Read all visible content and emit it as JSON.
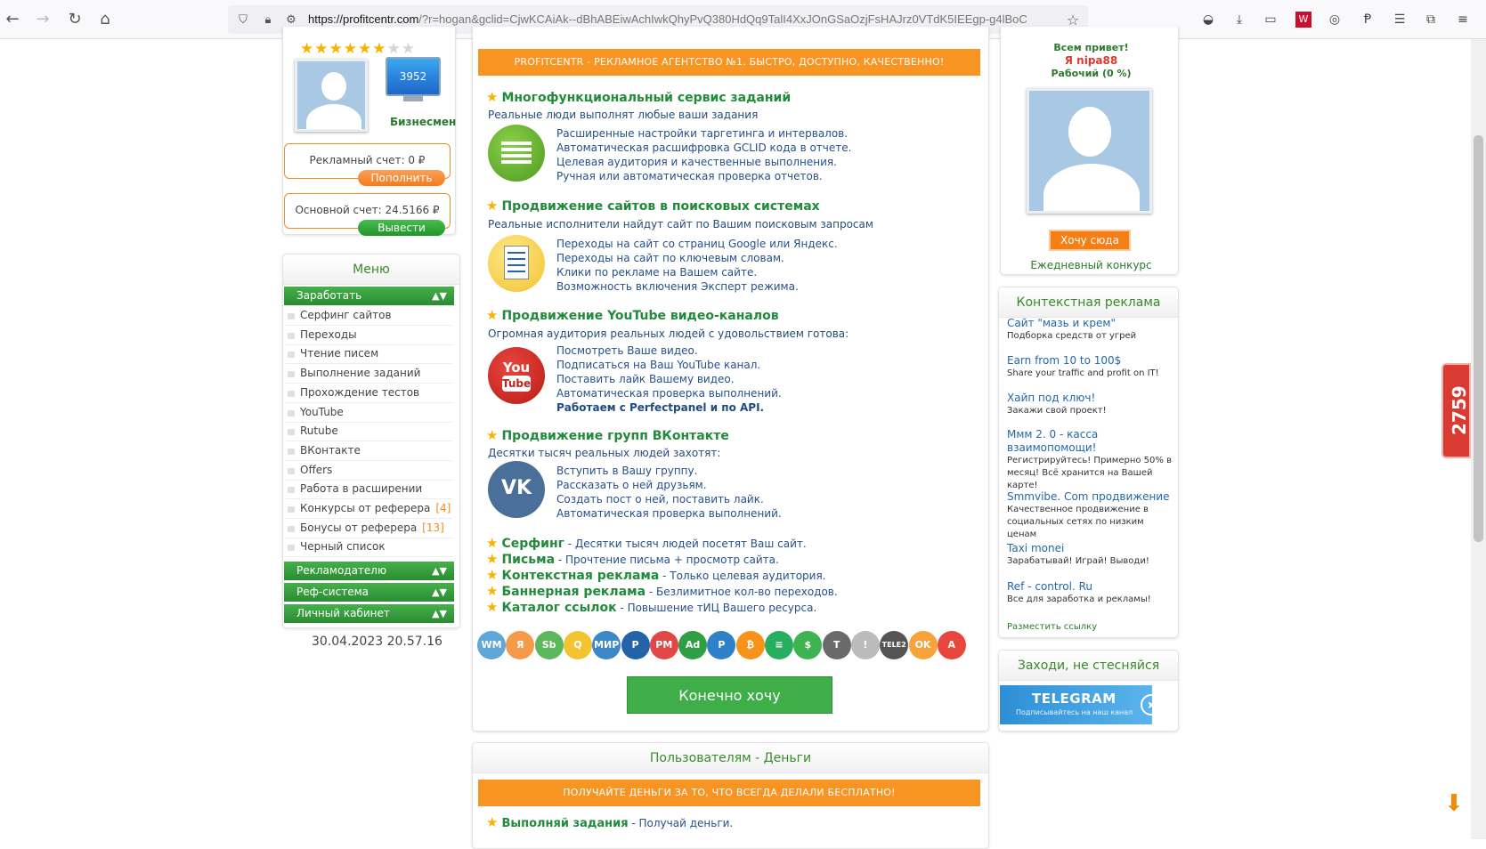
{
  "browser": {
    "url_host": "https://profitcentr.com",
    "url_rest": "/?r=hogan&gclid=CjwKCAiAk--dBhABEiwAchIwkQhyPvQ380HdQq9TalI4XxJOnGSaOzjFsHAJrz0VTdK5IEEgp-g4lBoC"
  },
  "left": {
    "stars_on": "★★★★★★",
    "stars_off": "★★",
    "monitor_value": "3952",
    "status": "Бизнесмен",
    "ad_account": "Рекламный счет: 0 ₽",
    "ad_account_btn": "Пополнить",
    "main_account": "Основной счет: 24.5166 ₽",
    "main_account_btn": "Вывести",
    "menu_title": "Меню",
    "menu_earn": "Заработать",
    "menu_items": [
      "Серфинг сайтов",
      "Переходы",
      "Чтение писем",
      "Выполнение заданий",
      "Прохождение тестов",
      "YouTube",
      "Rutube",
      "ВКонтакте",
      "Offers",
      "Работа в расширении",
      "Конкурсы от реферера",
      "Бонусы от реферера",
      "Черный список"
    ],
    "menu_counts": {
      "contest": "[4]",
      "bonus": "[13]"
    },
    "menu_adv": "Рекламодателю",
    "menu_ref": "Реф-система",
    "menu_cabinet": "Личный кабинет",
    "datetime": "30.04.2023 20.57.16"
  },
  "center": {
    "banner": "PROFITCENTR - РЕКЛАМНОЕ АГЕНТСТВО №1. БЫСТРО, ДОСТУПНО, КАЧЕСТВЕННО!",
    "s1_title": "Многофункциональный сервис заданий",
    "s1_sub": "Реальные люди выполнят любые ваши задания",
    "s1_lines": [
      "Расширенные настройки таргетинга и интервалов.",
      "Автоматическая расшифровка GCLID кода в отчете.",
      "Целевая аудитория и качественные выполнения.",
      "Ручная или автоматическая проверка отчетов."
    ],
    "s2_title": "Продвижение сайтов в поисковых системах",
    "s2_sub": "Реальные исполнители найдут сайт по Вашим поисковым запросам",
    "s2_lines": [
      "Переходы на сайт со страниц Google или Яндекс.",
      "Переходы на сайт по ключевым словам.",
      "Клики по рекламе на Вашем сайте.",
      "Возможность включения Эксперт режима."
    ],
    "s3_title": "Продвижение YouTube видео-каналов",
    "s3_sub": "Огромная аудитория реальных людей с удовольствием готова:",
    "s3_lines": [
      "Посмотреть Ваше видео.",
      "Подписаться на Ваш YouTube канал.",
      "Поставить лайк Вашему видео.",
      "Автоматическая проверка выполнений."
    ],
    "s3_bold": "Работаем с Perfectpanel и по API.",
    "yt_you": "You",
    "yt_tube": "Tube",
    "s4_title": "Продвижение групп ВКонтакте",
    "s4_sub": "Десятки тысяч реальных людей захотят:",
    "s4_lines": [
      "Вступить в Вашу группу.",
      "Рассказать о ней друзьям.",
      "Создать пост о ней, поставить лайк.",
      "Автоматическая проверка выполнений."
    ],
    "vk_logo": "VK",
    "features": [
      {
        "name": "Серфинг",
        "desc": " - Десятки тысяч людей посетят Ваш сайт."
      },
      {
        "name": "Письма",
        "desc": " - Прочтение письма + просмотр сайта."
      },
      {
        "name": "Контекстная реклама",
        "desc": " - Только целевая аудитория."
      },
      {
        "name": "Баннерная реклама",
        "desc": " - Безлимитное кол-во переходов."
      },
      {
        "name": "Каталог ссылок",
        "desc": " - Повышение тИЦ Вашего ресурса."
      }
    ],
    "payments": [
      "WM",
      "Я",
      "Sb",
      "Q",
      "МИР",
      "P",
      "PM",
      "Ad",
      "P",
      "₿",
      "≡",
      "$",
      "T",
      "!",
      "TELE2",
      "OK",
      "A"
    ],
    "cta": "Конечно хочу",
    "users_title": "Пользователям - Деньги",
    "users_banner": "ПОЛУЧАЙТЕ ДЕНЬГИ ЗА ТО, ЧТО ВСЕГДА ДЕЛАЛИ БЕСПЛАТНО!",
    "users_first_name": "Выполняй задания",
    "users_first_desc": " - Получай деньги."
  },
  "right": {
    "hello": "Всем привет!",
    "name": "Я nipa88",
    "role": "Рабочий (0 %)",
    "want_btn": "Хочу сюда",
    "daily": "Ежедневный конкурс",
    "ctx_title": "Контекстная реклама",
    "ads": [
      {
        "t": "Сайт \"мазь и крем\"",
        "d": "Подборка средств от угрей"
      },
      {
        "t": "Earn from 10 to 100$",
        "d": "Share your traffic and profit on IT!"
      },
      {
        "t": "Хайп под ключ!",
        "d": "Закажи свой проект!"
      },
      {
        "t": "Ммм 2. 0 - касса взаимопомощи!",
        "d": "Регистрируйтесь! Примерно 50% в месяц! Всё хранится на Вашей карте!"
      },
      {
        "t": "Smmvibe. Com продвижение",
        "d": "Качественное продвижение в социальных сетях по низким ценам"
      },
      {
        "t": "Taxi monei",
        "d": "Зарабатывай! Играй! Выводи!"
      },
      {
        "t": "Ref - control. Ru",
        "d": "Все для заработка и рекламы!"
      }
    ],
    "place_link": "Разместить ссылку",
    "come_title": "Заходи, не стесняйся",
    "tg_title": "TELEGRAM",
    "tg_sub": "Подписывайтесь на наш канал"
  },
  "side_counter": "2759",
  "colors": {
    "green": "#3a8a2b",
    "orange": "#f79422",
    "link": "#26508a"
  }
}
